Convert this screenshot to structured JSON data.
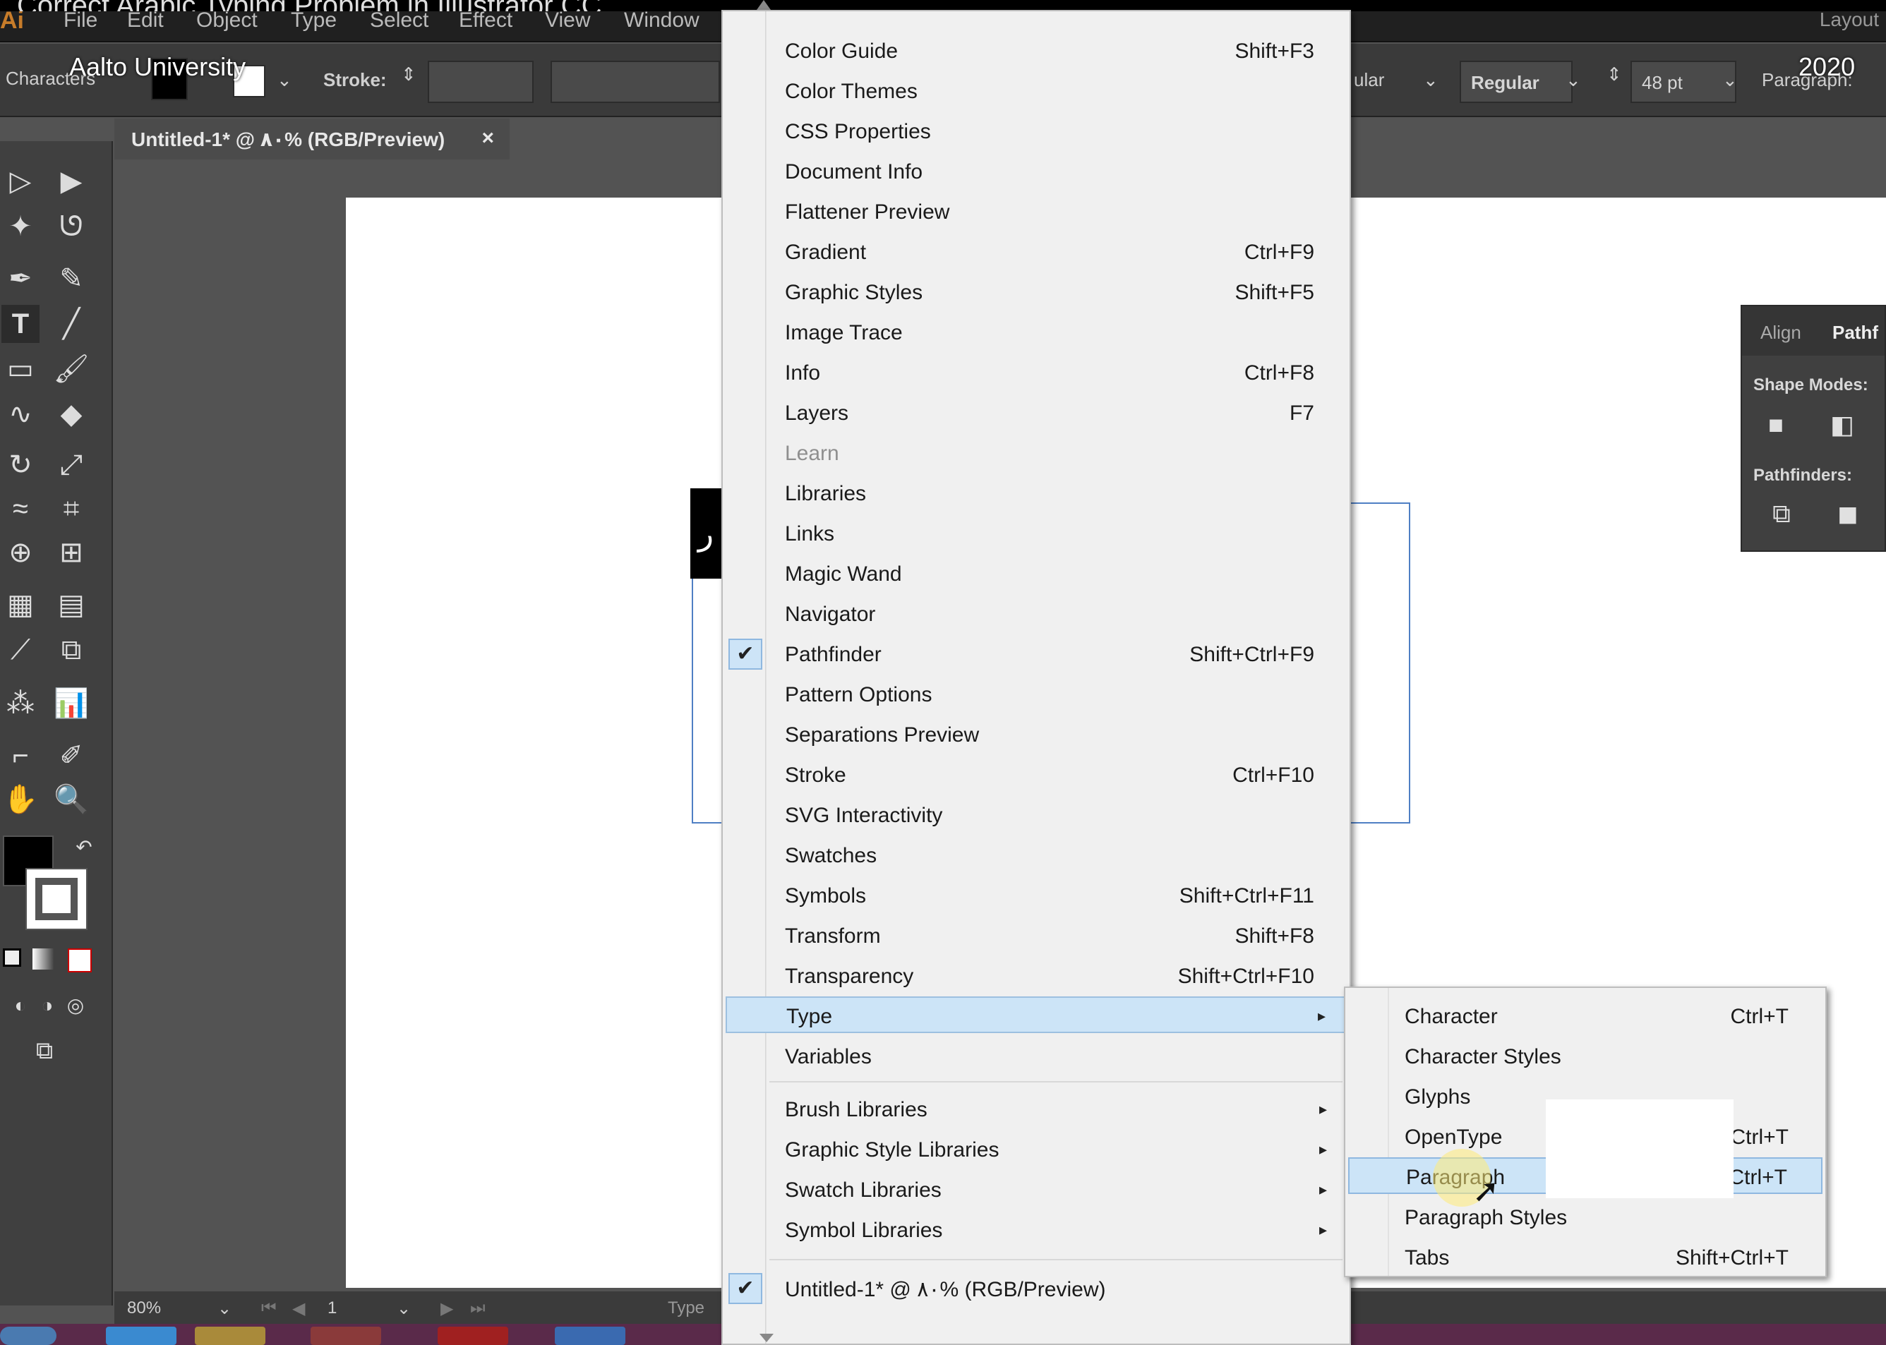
{
  "video": {
    "title": "Correct Arabic Typing Problem in Illustrator CC",
    "channel": "Aalto University",
    "year": "2020"
  },
  "menubar": {
    "logo": "Ai",
    "items": [
      "File",
      "Edit",
      "Object",
      "Type",
      "Select",
      "Effect",
      "View",
      "Window"
    ],
    "workspace": "Layout"
  },
  "controlbar": {
    "characters_label": "Characters",
    "stroke_label": "Stroke:",
    "font_style_partial": "ular",
    "font_style": "Regular",
    "font_size": "48 pt",
    "paragraph_label": "Paragraph:"
  },
  "document_tab": {
    "title": "Untitled-1* @ ٨٠% (RGB/Preview)",
    "close": "×"
  },
  "canvas": {
    "glyph": "ر"
  },
  "pathfinder_panel": {
    "tab_align": "Align",
    "tab_pathfinder": "Pathf",
    "shape_modes": "Shape Modes:",
    "pathfinders": "Pathfinders:"
  },
  "statusbar": {
    "zoom": "80%",
    "page": "1",
    "tool": "Type"
  },
  "window_menu": {
    "items": [
      {
        "label": "Color Guide",
        "shortcut": "Shift+F3"
      },
      {
        "label": "Color Themes",
        "shortcut": ""
      },
      {
        "label": "CSS Properties",
        "shortcut": ""
      },
      {
        "label": "Document Info",
        "shortcut": ""
      },
      {
        "label": "Flattener Preview",
        "shortcut": ""
      },
      {
        "label": "Gradient",
        "shortcut": "Ctrl+F9"
      },
      {
        "label": "Graphic Styles",
        "shortcut": "Shift+F5"
      },
      {
        "label": "Image Trace",
        "shortcut": ""
      },
      {
        "label": "Info",
        "shortcut": "Ctrl+F8"
      },
      {
        "label": "Layers",
        "shortcut": "F7"
      },
      {
        "label": "Learn",
        "shortcut": ""
      },
      {
        "label": "Libraries",
        "shortcut": ""
      },
      {
        "label": "Links",
        "shortcut": ""
      },
      {
        "label": "Magic Wand",
        "shortcut": ""
      },
      {
        "label": "Navigator",
        "shortcut": ""
      },
      {
        "label": "Pathfinder",
        "shortcut": "Shift+Ctrl+F9"
      },
      {
        "label": "Pattern Options",
        "shortcut": ""
      },
      {
        "label": "Separations Preview",
        "shortcut": ""
      },
      {
        "label": "Stroke",
        "shortcut": "Ctrl+F10"
      },
      {
        "label": "SVG Interactivity",
        "shortcut": ""
      },
      {
        "label": "Swatches",
        "shortcut": ""
      },
      {
        "label": "Symbols",
        "shortcut": "Shift+Ctrl+F11"
      },
      {
        "label": "Transform",
        "shortcut": "Shift+F8"
      },
      {
        "label": "Transparency",
        "shortcut": "Shift+Ctrl+F10"
      },
      {
        "label": "Type",
        "shortcut": ""
      },
      {
        "label": "Variables",
        "shortcut": ""
      }
    ],
    "libraries": [
      {
        "label": "Brush Libraries"
      },
      {
        "label": "Graphic Style Libraries"
      },
      {
        "label": "Swatch Libraries"
      },
      {
        "label": "Symbol Libraries"
      }
    ],
    "open_document": {
      "label": "Untitled-1* @ ٨٠% (RGB/Preview)"
    },
    "check_glyph": "✔",
    "submenu_arrow": "▸"
  },
  "type_submenu": {
    "items": [
      {
        "label": "Character",
        "shortcut": "Ctrl+T"
      },
      {
        "label": "Character Styles",
        "shortcut": ""
      },
      {
        "label": "Glyphs",
        "shortcut": ""
      },
      {
        "label": "OpenType",
        "shortcut": "Ctrl+T"
      },
      {
        "label": "Paragraph",
        "shortcut": "Ctrl+T"
      },
      {
        "label": "Paragraph Styles",
        "shortcut": ""
      },
      {
        "label": "Tabs",
        "shortcut": "Shift+Ctrl+T"
      }
    ]
  },
  "colors": {
    "menu_bg": "#f0f0f0",
    "highlight": "#cce4f7",
    "highlight_border": "#9dc0e0",
    "app_bg": "#535353",
    "selection_frame": "#4f7fc4"
  },
  "icons": {
    "check": "checkmark-icon",
    "submenu": "submenu-arrow-icon",
    "cursor": "mouse-cursor-icon"
  }
}
